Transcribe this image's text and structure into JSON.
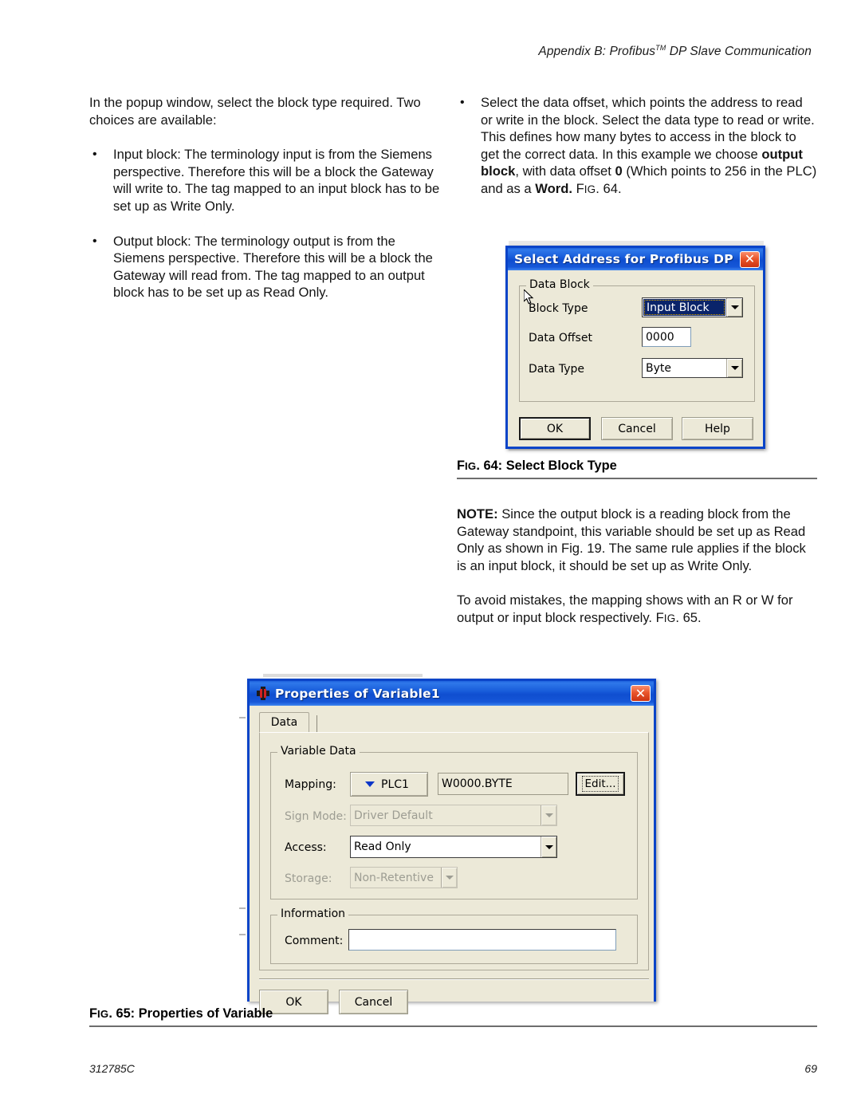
{
  "page": {
    "header": "Appendix B: Profibus",
    "header_tm": "TM",
    "header_rest": " DP Slave Communication",
    "footer_left": "312785C",
    "footer_right": "69"
  },
  "left_column": {
    "intro": "In the popup window, select the block type required. Two choices are available:",
    "bullets": [
      {
        "marker": "•",
        "text": "Input block: The terminology input is from the Siemens perspective. Therefore this will be a block the Gateway will write to. The tag mapped to an input block has to be set up as Write Only."
      },
      {
        "marker": "•",
        "text": "Output block: The terminology output is from the Siemens perspective. Therefore this will be a block the Gateway will read from. The tag mapped to an output block has to be set up as Read Only."
      }
    ]
  },
  "right_column": {
    "bullet_marker": "•",
    "bullet_part1": "Select the data offset, which points the address to read or write in the block. Select the data type to read or write. This defines how many bytes to access in the block to get the correct data. In this example we choose ",
    "bullet_bold1": "output block",
    "bullet_part2": ", with data offset ",
    "bullet_bold2": "0",
    "bullet_part3": " (Which points to 256 in the PLC) and as a ",
    "bullet_bold3": "Word.",
    "bullet_fig_sc": "F",
    "bullet_fig_rest": "IG",
    "bullet_fig_num": ". 64.",
    "note_bold": "NOTE:",
    "note_text": " Since the output block is a reading block from the Gateway standpoint, this variable should be set up as Read Only as shown in Fig. 19. The same rule applies if the block is an input block, it should be set up as Write Only.",
    "para2_text": "To avoid mistakes, the mapping shows with an R or W for output or input block respectively. ",
    "para2_fig_sc": "F",
    "para2_fig_rest": "IG",
    "para2_fig_num": ". 65."
  },
  "captions": {
    "fig64_prefix_f": "F",
    "fig64_prefix_ig": "IG",
    "fig64_text": ". 64: Select Block Type",
    "fig65_prefix_f": "F",
    "fig65_prefix_ig": "IG",
    "fig65_text": ". 65: Properties of Variable"
  },
  "dialog_select_address": {
    "title": "Select Address for Profibus DP",
    "close_glyph": "✕",
    "group_label": "Data Block",
    "fields": [
      {
        "label": "Block Type",
        "value": "Input Block",
        "control": "combobox-selected"
      },
      {
        "label": "Data Offset",
        "value": "0000",
        "control": "textbox"
      },
      {
        "label": "Data Type",
        "value": "Byte",
        "control": "combobox"
      }
    ],
    "buttons": [
      {
        "label": "OK",
        "default": true
      },
      {
        "label": "Cancel",
        "default": false
      },
      {
        "label": "Help",
        "default": false
      }
    ]
  },
  "dialog_properties": {
    "title": "Properties of Variable1",
    "close_glyph": "✕",
    "tab": "Data",
    "group_variable_data": "Variable Data",
    "group_information": "Information",
    "mapping_label": "Mapping:",
    "mapping_button": "PLC1",
    "mapping_value": "W0000.BYTE",
    "edit_button": "Edit...",
    "sign_mode_label": "Sign Mode:",
    "sign_mode_value": "Driver Default",
    "access_label": "Access:",
    "access_value": "Read Only",
    "storage_label": "Storage:",
    "storage_value": "Non-Retentive",
    "comment_label": "Comment:",
    "comment_value": "",
    "buttons": [
      {
        "label": "OK"
      },
      {
        "label": "Cancel"
      }
    ]
  },
  "colors": {
    "titlebar_blue": "#0f4ed0",
    "dialog_face": "#ece9d8",
    "selection_blue": "#0a246a",
    "close_red": "#cc3311",
    "caption_rule": "#6d6d6d"
  }
}
